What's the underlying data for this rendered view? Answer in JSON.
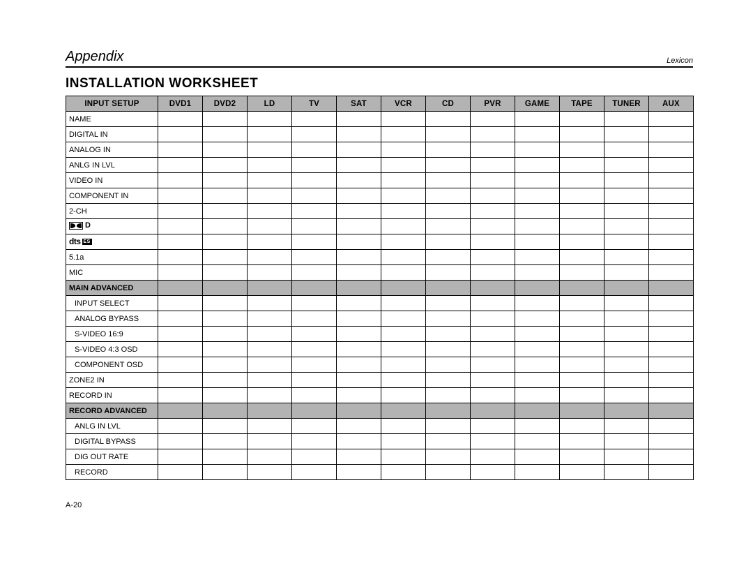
{
  "header": {
    "section": "Appendix",
    "brand": "Lexicon"
  },
  "title": "INSTALLATION WORKSHEET",
  "table": {
    "head_label": "INPUT SETUP",
    "inputs": [
      "DVD1",
      "DVD2",
      "LD",
      "TV",
      "SAT",
      "VCR",
      "CD",
      "PVR",
      "GAME",
      "TAPE",
      "TUNER",
      "AUX"
    ],
    "rows": [
      {
        "label": "NAME",
        "type": "bold"
      },
      {
        "label": "DIGITAL IN",
        "type": "bold"
      },
      {
        "label": "ANALOG IN",
        "type": "bold"
      },
      {
        "label": "ANLG IN LVL",
        "type": "bold"
      },
      {
        "label": "VIDEO IN",
        "type": "bold"
      },
      {
        "label": "COMPONENT IN",
        "type": "bold"
      },
      {
        "label": "2-CH",
        "type": "bold"
      },
      {
        "label": "",
        "type": "dolby"
      },
      {
        "label": "",
        "type": "dts"
      },
      {
        "label": "5.1a",
        "type": "bold"
      },
      {
        "label": "MIC",
        "type": "bold"
      },
      {
        "label": "MAIN ADVANCED",
        "type": "section"
      },
      {
        "label": "INPUT SELECT",
        "type": "sub"
      },
      {
        "label": "ANALOG BYPASS",
        "type": "sub"
      },
      {
        "label": "S-VIDEO 16:9",
        "type": "sub"
      },
      {
        "label": "S-VIDEO 4:3 OSD",
        "type": "sub"
      },
      {
        "label": "COMPONENT OSD",
        "type": "sub"
      },
      {
        "label": "ZONE2 IN",
        "type": "bold"
      },
      {
        "label": "RECORD IN",
        "type": "bold"
      },
      {
        "label": "RECORD ADVANCED",
        "type": "section"
      },
      {
        "label": "ANLG IN LVL",
        "type": "sub"
      },
      {
        "label": "DIGITAL BYPASS",
        "type": "sub"
      },
      {
        "label": "DIG OUT RATE",
        "type": "sub"
      },
      {
        "label": "RECORD",
        "type": "sub"
      }
    ]
  },
  "dts_label": "dts",
  "dts_es_label": "ES",
  "dolby_d_label": "D",
  "footer": "A-20"
}
